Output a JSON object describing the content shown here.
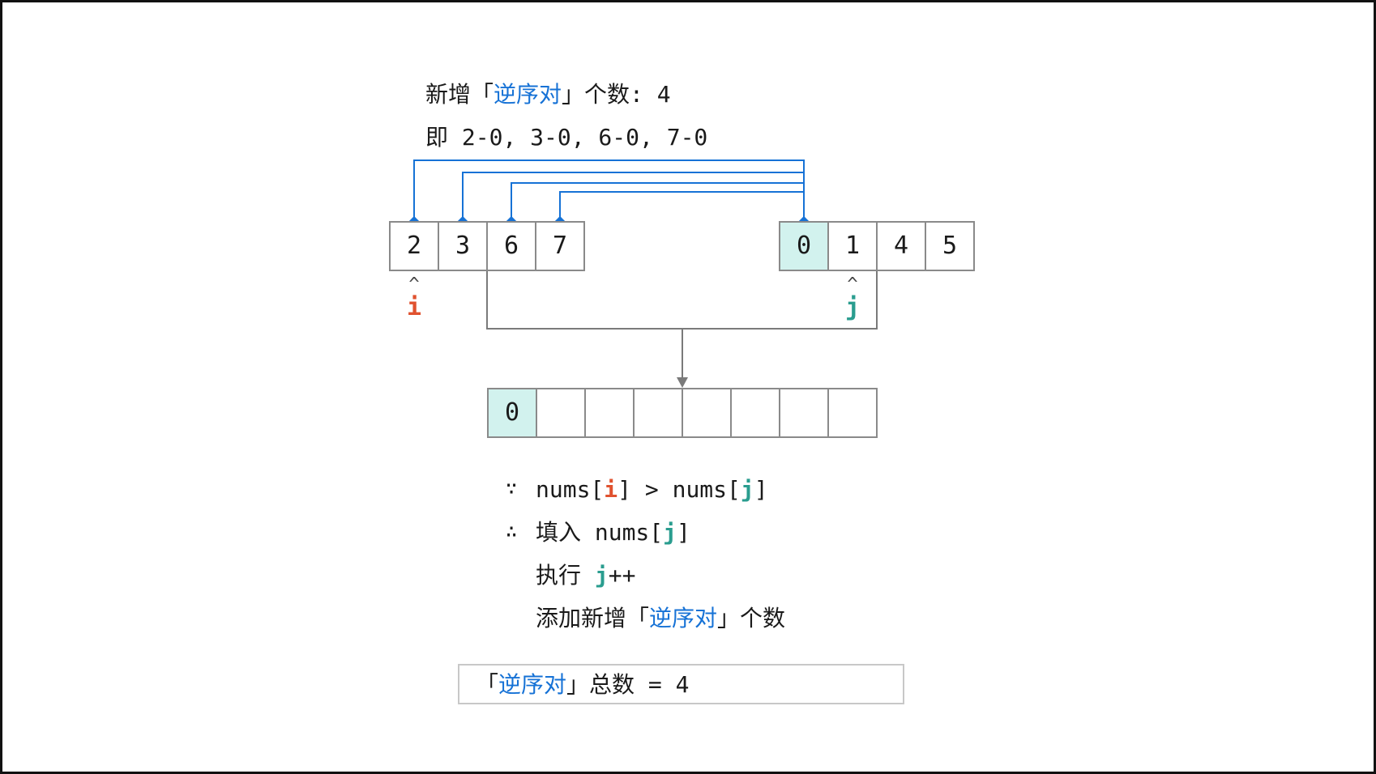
{
  "header": {
    "line1_pre": "新增「",
    "line1_kw": "逆序对",
    "line1_post": "」个数: 4",
    "line2": "即 2-0, 3-0, 6-0, 7-0"
  },
  "left_array": [
    "2",
    "3",
    "6",
    "7"
  ],
  "right_array": [
    "0",
    "1",
    "4",
    "5"
  ],
  "merged_array": [
    "0",
    "",
    "",
    "",
    "",
    "",
    "",
    ""
  ],
  "pointers": {
    "i_caret": "^",
    "i": "i",
    "j_caret": "^",
    "j": "j"
  },
  "explanation": {
    "because_sym": "∵",
    "because_a": "nums[",
    "because_i": "i",
    "because_b": "] > nums[",
    "because_j": "j",
    "because_c": "]",
    "therefore_sym": "∴",
    "fill_a": "填入 nums[",
    "fill_j": "j",
    "fill_b": "]",
    "exec_a": "执行 ",
    "exec_j": "j",
    "exec_b": "++",
    "add_pre": "添加新增「",
    "add_kw": "逆序对",
    "add_post": "」个数"
  },
  "result": {
    "pre": "「",
    "kw": "逆序对",
    "post": "」总数 = 4"
  },
  "colors": {
    "accent_blue": "#1672d6",
    "highlight_fill": "#d2f2ee",
    "i_color": "#e0522f",
    "j_color": "#2a9d8f",
    "cell_border": "#8a8a8a"
  }
}
